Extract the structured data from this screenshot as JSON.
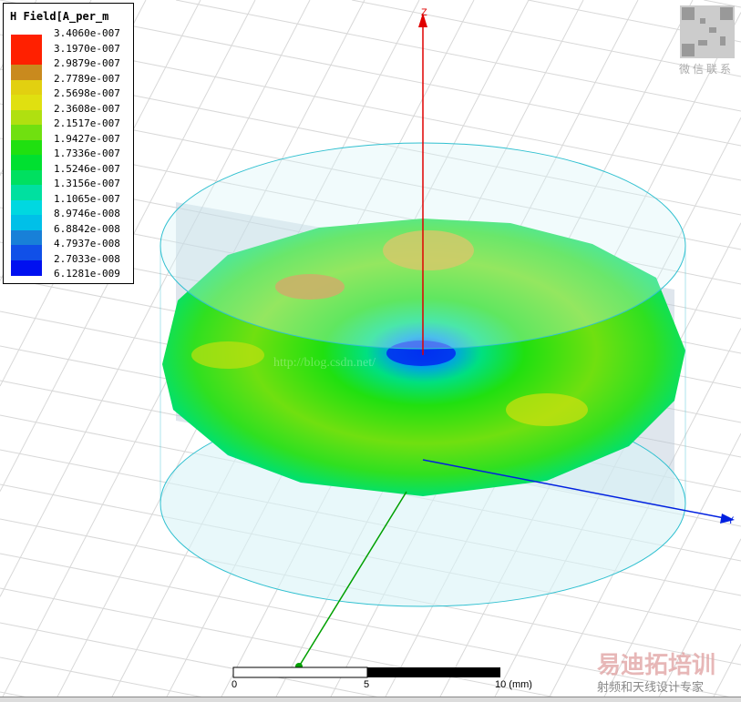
{
  "legend": {
    "title": "H Field[A_per_m",
    "values": [
      "3.4060e-007",
      "3.1970e-007",
      "2.9879e-007",
      "2.7789e-007",
      "2.5698e-007",
      "2.3608e-007",
      "2.1517e-007",
      "1.9427e-007",
      "1.7336e-007",
      "1.5246e-007",
      "1.3156e-007",
      "1.1065e-007",
      "8.9746e-008",
      "6.8842e-008",
      "4.7937e-008",
      "2.7033e-008",
      "6.1281e-009"
    ],
    "colors": [
      "#ff2000",
      "#ff2000",
      "#c98a1e",
      "#e2d010",
      "#e0e010",
      "#b0e010",
      "#70e010",
      "#20e010",
      "#00e030",
      "#00e060",
      "#00e0a0",
      "#00d8e0",
      "#00c0e8",
      "#1880d8",
      "#1050e8",
      "#0010f0"
    ]
  },
  "axes": {
    "z": "Z",
    "y": "Y",
    "x_color": "#00a000",
    "y_color": "#0020e0",
    "z_color": "#e00000"
  },
  "scale_bar": {
    "labels": [
      "0",
      "5",
      "10 (mm)"
    ]
  },
  "watermarks": {
    "url": "http://blog.csdn.net/",
    "qr_caption": "微信联系",
    "brand": "易迪拓培训",
    "tagline": "射频和天线设计专家"
  }
}
